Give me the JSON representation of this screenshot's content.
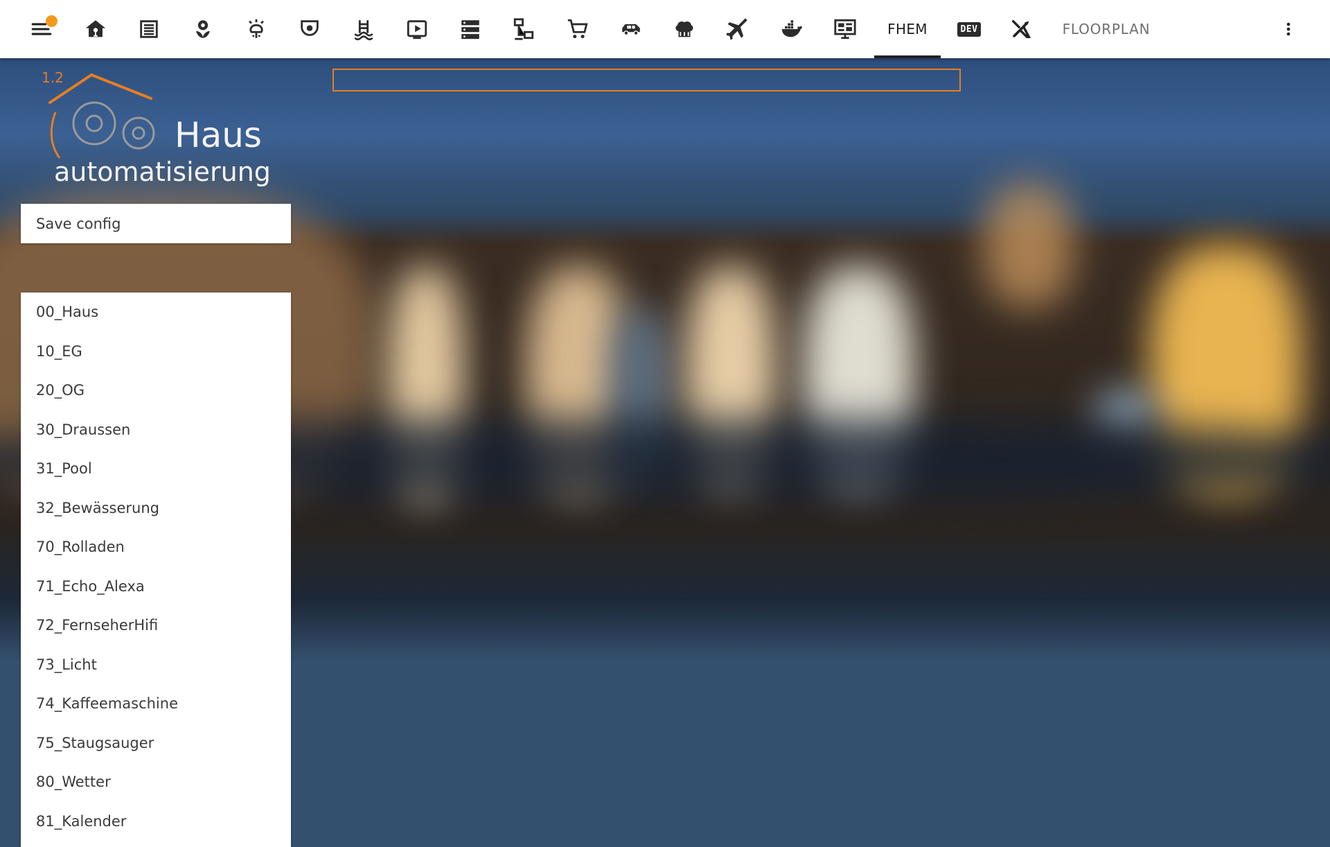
{
  "toolbar": {
    "menu_icon": "hamburger-menu-icon",
    "notification_color": "#f39a1e",
    "icons": [
      {
        "name": "home-icon"
      },
      {
        "name": "garage-icon"
      },
      {
        "name": "garden-flower-icon"
      },
      {
        "name": "sprinkler-icon"
      },
      {
        "name": "security-camera-icon"
      },
      {
        "name": "pool-icon"
      },
      {
        "name": "media-play-icon"
      },
      {
        "name": "server-icon"
      },
      {
        "name": "network-icon"
      },
      {
        "name": "shopping-cart-icon"
      },
      {
        "name": "car-icon"
      },
      {
        "name": "chef-hat-icon"
      },
      {
        "name": "airplane-icon"
      },
      {
        "name": "docker-icon"
      },
      {
        "name": "monitor-dashboard-icon"
      }
    ],
    "active_tab": "FHEM",
    "dev_label": "DEV",
    "tools_icon": "tools-icon",
    "floorplan_label": "FLOORPLAN",
    "more_icon": "more-vert-icon"
  },
  "logo": {
    "version": "1.2",
    "line1": "Haus",
    "line2": "automatisierung",
    "accent_color": "#e67e22"
  },
  "search": {
    "value": "",
    "border_color": "#e67e22"
  },
  "sidebar": {
    "save_label": "Save config",
    "rooms": [
      "00_Haus",
      "10_EG",
      "20_OG",
      "30_Draussen",
      "31_Pool",
      "32_Bewässerung",
      "70_Rolladen",
      "71_Echo_Alexa",
      "72_FernseherHifi",
      "73_Licht",
      "74_Kaffeemaschine",
      "75_Staugsauger",
      "80_Wetter",
      "81_Kalender"
    ]
  }
}
